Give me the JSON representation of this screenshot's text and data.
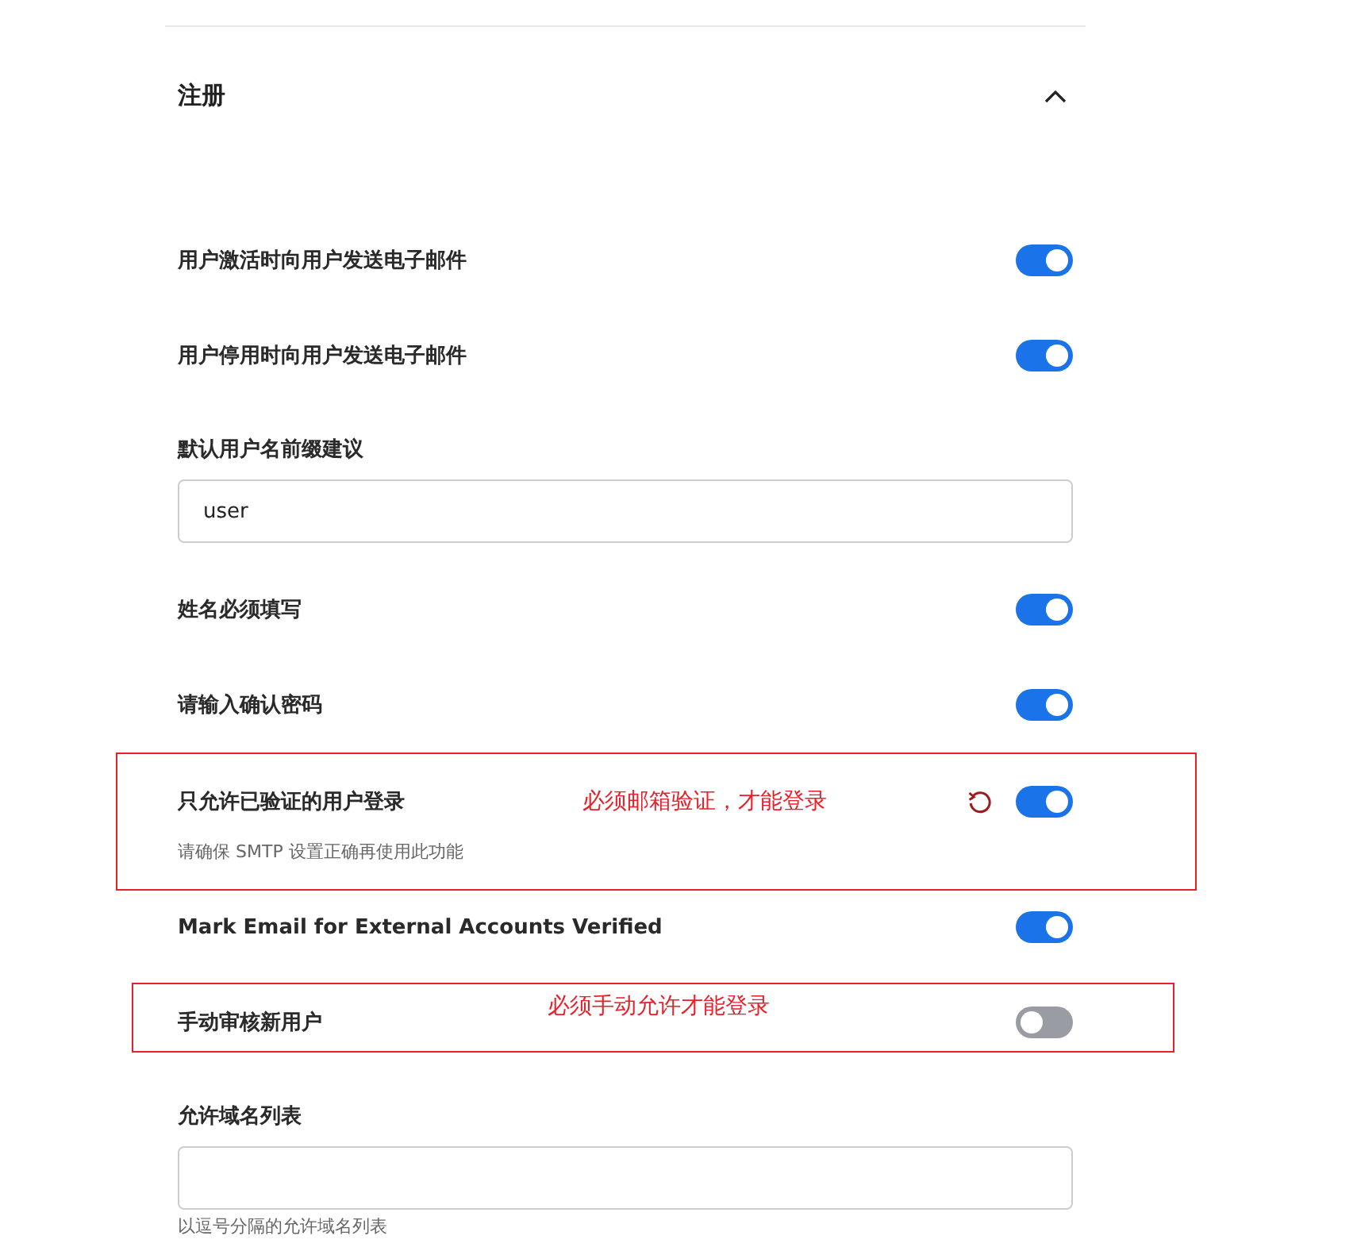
{
  "section": {
    "title": "注册",
    "expanded": true
  },
  "items": [
    {
      "kind": "toggle",
      "label": "用户激活时向用户发送电子邮件",
      "on": true
    },
    {
      "kind": "toggle",
      "label": "用户停用时向用户发送电子邮件",
      "on": true
    },
    {
      "kind": "text_input",
      "label": "默认用户名前缀建议",
      "value": "user"
    },
    {
      "kind": "toggle",
      "label": "姓名必须填写",
      "on": true
    },
    {
      "kind": "toggle",
      "label": "请输入确认密码",
      "on": true
    },
    {
      "kind": "toggle",
      "label": "只允许已验证的用户登录",
      "on": true,
      "reset": true,
      "hint": "请确保 SMTP 设置正确再使用此功能",
      "note": "必须邮箱验证，才能登录"
    },
    {
      "kind": "toggle",
      "label": "Mark Email for External Accounts Verified",
      "on": true
    },
    {
      "kind": "toggle",
      "label": "手动审核新用户",
      "on": false,
      "note": "必须手动允许才能登录"
    },
    {
      "kind": "text_input",
      "label": "允许域名列表",
      "hint": "以逗号分隔的允许域名列表"
    }
  ]
}
